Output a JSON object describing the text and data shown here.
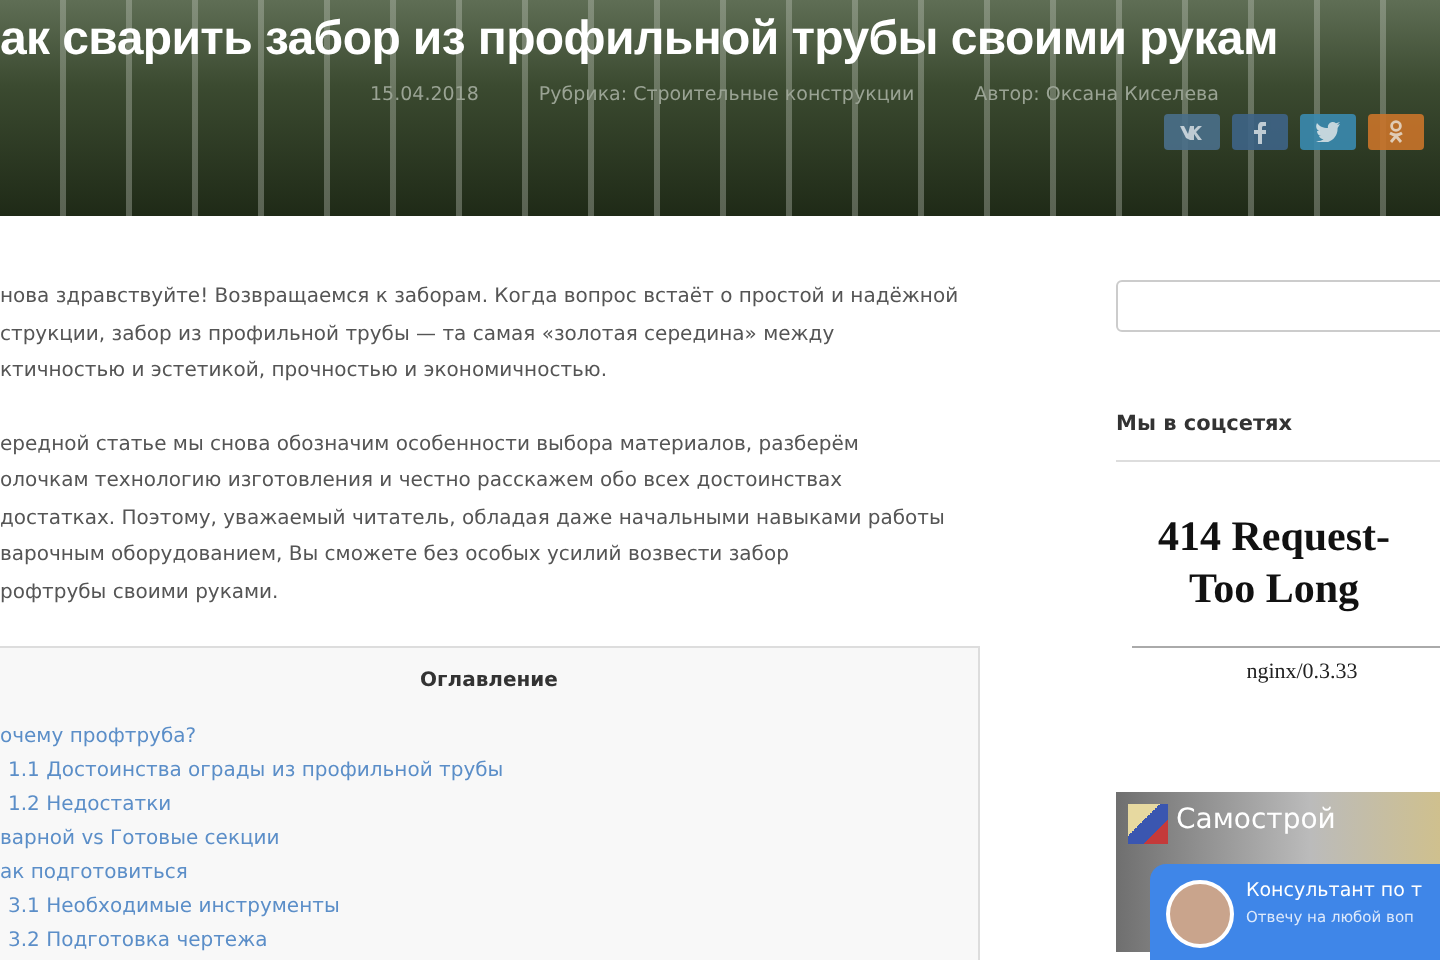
{
  "header": {
    "title": "ак сварить забор из профильной трубы своими рукам",
    "meta": [
      "15.04.2018",
      "Рубрика: Строительные конструкции",
      "Автор: Оксана Киселева"
    ],
    "share_buttons": [
      {
        "kind": "vk",
        "color": "#4a6f8a"
      },
      {
        "kind": "facebook",
        "color": "#3e6487"
      },
      {
        "kind": "twitter",
        "color": "#3a8ab0"
      },
      {
        "kind": "ok",
        "color": "#c9742a"
      }
    ]
  },
  "article": {
    "paragraphs": [
      [
        "нова здравствуйте! Возвращаемся к заборам. Когда вопрос встаёт о простой и надёжной",
        "струкции, забор из профильной трубы — та самая «золотая середина» между",
        "ктичностью и эстетикой, прочностью и экономичностью."
      ],
      [
        "ередной статье мы снова обозначим особенности выбора материалов, разберём",
        "олочкам технологию изготовления и честно расскажем обо всех достоинствах",
        "достатках. Поэтому, уважаемый читатель, обладая даже начальными навыками работы",
        "варочным оборудованием, Вы сможете без особых усилий возвести забор",
        "рофтрубы своими руками."
      ]
    ]
  },
  "toc": {
    "title": "Оглавление",
    "items": [
      {
        "label": "очему профтруба?",
        "children": [
          {
            "label": "1.1 Достоинства ограды из профильной трубы"
          },
          {
            "label": "1.2 Недостатки"
          }
        ]
      },
      {
        "label": "варной vs Готовые секции"
      },
      {
        "label": "ак подготовиться",
        "children": [
          {
            "label": "3.1 Необходимые инструменты"
          },
          {
            "label": "3.2 Подготовка чертежа"
          }
        ]
      }
    ]
  },
  "sidebar": {
    "social_heading": "Мы в соцсетях",
    "error_frame": {
      "title_lines": [
        "414 Request-",
        "Too Long"
      ],
      "server": "nginx/0.3.33"
    },
    "group_widget": {
      "name": "Самострой"
    }
  },
  "chat_widget": {
    "title": "Консультант по т",
    "subtitle": "Отвечу на любой воп"
  }
}
